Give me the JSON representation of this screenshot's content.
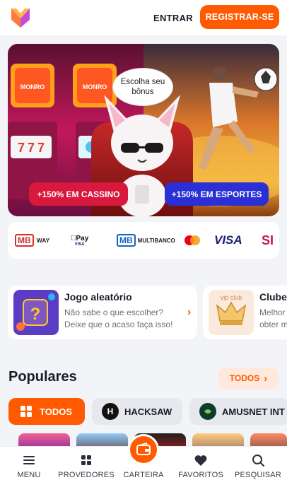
{
  "header": {
    "login_label": "ENTRAR",
    "register_label": "REGISTRAR-SE"
  },
  "hero": {
    "bubble_text": "Escolha seu bônus",
    "casino_label": "+150% EM CASSINO",
    "sports_label": "+150% EM ESPORTES",
    "slot_sign_text": "MONRO",
    "slot_reel_text": "7"
  },
  "payments": [
    {
      "name": "mbway",
      "icon": "mbway-logo",
      "text": "MB",
      "sub": "WAY"
    },
    {
      "name": "applepay",
      "icon": "applepay-logo",
      "text": "Pay",
      "sub": "VISA"
    },
    {
      "name": "multibanco",
      "icon": "multibanco-logo",
      "text": "MB",
      "sub": "MULTIBANCO"
    },
    {
      "name": "mastercard",
      "icon": "mastercard-logo"
    },
    {
      "name": "visa",
      "icon": "visa-logo",
      "text": "VISA"
    },
    {
      "name": "sibs",
      "icon": "sibs-logo",
      "text": "SI"
    }
  ],
  "cards": [
    {
      "title": "Jogo aleatório",
      "desc_line1": "Não sabe o que escolher?",
      "desc_line2": "Deixe que o acaso faça isso!",
      "arrow": "›"
    },
    {
      "title": "Clube",
      "desc_line1": "Melhor",
      "desc_line2": "obter m",
      "thumb_text": "vip club"
    }
  ],
  "populares": {
    "title": "Populares",
    "all_label": "TODOS",
    "chips": [
      {
        "label": "TODOS",
        "icon": "grid-icon"
      },
      {
        "label": "HACKSAW",
        "icon": "hacksaw-icon",
        "icon_text": "H"
      },
      {
        "label": "AMUSNET INT",
        "icon": "amusnet-icon"
      }
    ]
  },
  "bottom_nav": [
    {
      "label": "MENU",
      "icon": "menu-icon"
    },
    {
      "label": "PROVEDORES",
      "icon": "grid-icon"
    },
    {
      "label": "CARTEIRA",
      "icon": "wallet-icon"
    },
    {
      "label": "FAVORITOS",
      "icon": "heart-icon"
    },
    {
      "label": "PESQUISAR",
      "icon": "search-icon"
    }
  ],
  "colors": {
    "accent": "#ff5a00",
    "casino": "#d8183c",
    "sports": "#2a2fd6",
    "background": "#f3f4f7"
  }
}
